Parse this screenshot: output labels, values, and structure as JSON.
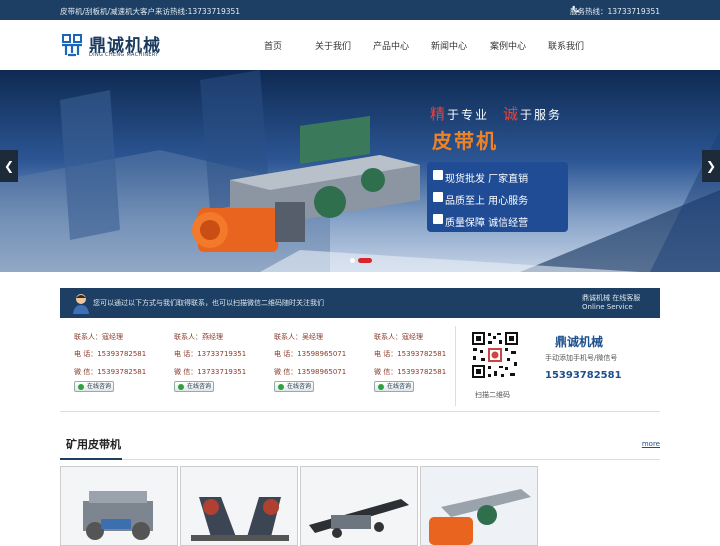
{
  "topbar": {
    "left_text": "皮带机/刮板机/减速机大客户来访热线:13733719351",
    "right_text": "服务热线：13733719351",
    "phone_icon": "phone-icon"
  },
  "header": {
    "logo_name": "鼎诚机械",
    "logo_sub": "DING CHENG MACHINERY",
    "nav": [
      "首页",
      "关于我们",
      "产品中心",
      "新闻中心",
      "案例中心",
      "联系我们"
    ]
  },
  "banner": {
    "slogan_1_red": "精",
    "slogan_1": "于专业",
    "slogan_2_red": "诚",
    "slogan_2": "于服务",
    "title": "皮带机",
    "features": [
      "现货批发 厂家直销",
      "品质至上 用心服务",
      "质量保障 诚信经营"
    ]
  },
  "contact_bar": {
    "intro": "您可以通过以下方式与我们取得联系，也可以扫描微信二维码随时关注我们",
    "service_title": "鼎诚机械 在线客服",
    "service_sub": "Online Service"
  },
  "contacts": [
    {
      "contact": "联系人：寇经理",
      "phone": "电  话：15393782581",
      "wechat": "微  信：15393782581",
      "qq": "在线咨询"
    },
    {
      "contact": "联系人：燕经理",
      "phone": "电  话：13733719351",
      "wechat": "微  信：13733719351",
      "qq": "在线咨询"
    },
    {
      "contact": "联系人：吴经理",
      "phone": "电  话：13598965071",
      "wechat": "微  信：13598965071",
      "qq": "在线咨询"
    },
    {
      "contact": "联系人：寇经理",
      "phone": "电  话：15393782581",
      "wechat": "微  信：15393782581",
      "qq": "在线咨询"
    }
  ],
  "qr": {
    "caption": "扫描二维码",
    "company": "鼎诚机械",
    "note": "手动添加手机号/微信号",
    "number": "15393782581"
  },
  "section": {
    "title": "矿用皮带机",
    "more": "more"
  },
  "colors": {
    "dark_blue": "#1c3f63",
    "accent_red": "#d7262c",
    "orange": "#f08226"
  }
}
